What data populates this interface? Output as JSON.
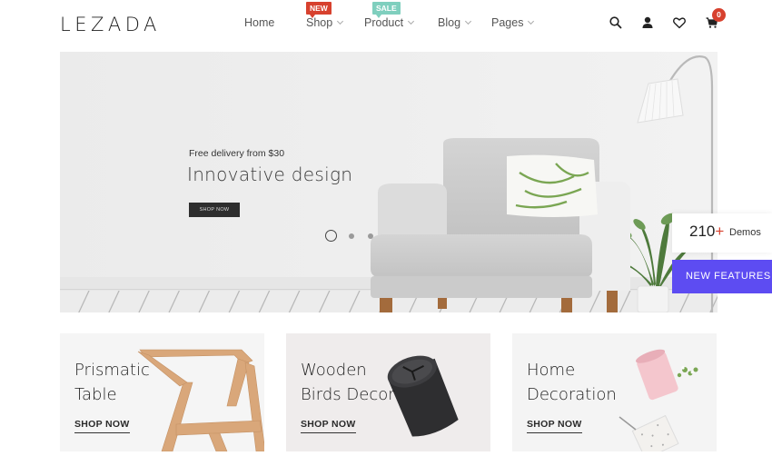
{
  "header": {
    "logo": "LEZADA",
    "nav": [
      {
        "label": "Home",
        "has_dropdown": false
      },
      {
        "label": "Shop",
        "has_dropdown": true,
        "badge": "NEW"
      },
      {
        "label": "Product",
        "has_dropdown": true,
        "badge": "SALE"
      },
      {
        "label": "Blog",
        "has_dropdown": true
      },
      {
        "label": "Pages",
        "has_dropdown": true
      }
    ],
    "icons": [
      "search-icon",
      "user-icon",
      "heart-icon",
      "cart-icon"
    ],
    "cart_count": "0"
  },
  "hero": {
    "subtitle": "Free delivery from $30",
    "title": "Innovative design",
    "button_label": "SHOP NOW",
    "slides": 3,
    "active_slide": 1
  },
  "widgets": {
    "demos_count": "210",
    "demos_plus": "+",
    "demos_label": "Demos",
    "features_label": "NEW FEATURES"
  },
  "categories": [
    {
      "title_line1": "Prismatic",
      "title_line2": "Table",
      "link": "SHOP NOW"
    },
    {
      "title_line1": "Wooden",
      "title_line2": "Birds Decor",
      "link": "SHOP NOW"
    },
    {
      "title_line1": "Home",
      "title_line2": "Decoration",
      "link": "SHOP NOW"
    }
  ],
  "colors": {
    "accent_red": "#d7412e",
    "sale_teal": "#7fcfbe",
    "features_purple": "#5d4cf2",
    "dark_button": "#2e2e2e"
  }
}
